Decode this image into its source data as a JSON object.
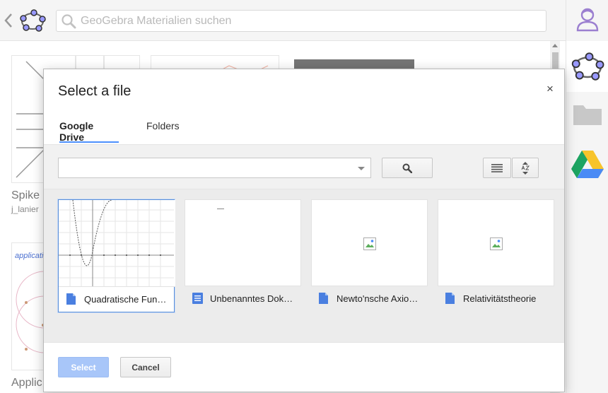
{
  "app": {
    "search_placeholder": "GeoGebra Materialien suchen",
    "bg_items": [
      {
        "title": "Spike S",
        "author": "j_lanier"
      },
      {
        "title": "Applic"
      }
    ],
    "bg_card_label": "application"
  },
  "dialog": {
    "title": "Select a file",
    "close_glyph": "×",
    "tabs": [
      {
        "label": "Google Drive",
        "active": true
      },
      {
        "label": "Folders",
        "active": false
      }
    ],
    "files": [
      {
        "name": "Quadratische Funk…",
        "selected": true,
        "thumbnail": "parabola-graph"
      },
      {
        "name": "Unbenanntes Dok…",
        "selected": false,
        "thumbnail": "blank-doc"
      },
      {
        "name": "Newto'nsche Axio…",
        "selected": false,
        "thumbnail": "broken-image"
      },
      {
        "name": "Relativitätstheorie",
        "selected": false,
        "thumbnail": "broken-image"
      }
    ],
    "select_label": "Select",
    "cancel_label": "Cancel"
  },
  "colors": {
    "accent": "#4d90fe",
    "select_disabled": "#a8c6f9",
    "doc_icon": "#4a7fe0"
  }
}
